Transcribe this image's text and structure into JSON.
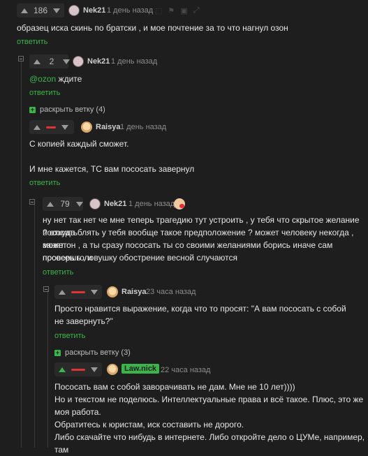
{
  "comments": [
    {
      "id": "c1",
      "score": "186",
      "author": "Nek21",
      "time": "1 день назад",
      "text": "образец иска скинь по братски , и мое почтение за то что нагнул озон",
      "reply": "ответить"
    },
    {
      "id": "c2",
      "score": "2",
      "author": "Nek21",
      "time": "1 день назад",
      "mention": "@ozon",
      "text": " ждите",
      "reply": "ответить",
      "expand": "раскрыть ветку (4)"
    },
    {
      "id": "c3",
      "author": "Raisya",
      "time": "1 день назад",
      "lines": [
        "С копией каждый сможет.",
        "И мне кажется, ТС вам пососать завернул"
      ],
      "reply": "ответить"
    },
    {
      "id": "c4",
      "score": "79",
      "author": "Nek21",
      "time": "1 день назад",
      "lines": [
        "ну нет так нет че мне теперь трагедию тут устроить , у тебя что скрытое желание пососать",
        "? откуда блять у тебя вообще такое предположение ? может человеку некогда , может",
        "занят он , а ты сразу пососать ты со своими желаниями борись иначе сам пососешь , и",
        "проверь головушку обострение весной случаются"
      ],
      "reply": "ответить"
    },
    {
      "id": "c5",
      "author": "Raisya",
      "time": "23 часа назад",
      "lines": [
        "Просто нравится выражение, когда что то просят: \"А вам пососать с собой",
        "не завернуть?\""
      ],
      "reply": "ответить",
      "expand": "раскрыть ветку (3)"
    },
    {
      "id": "c6",
      "author": "Law.nick",
      "time": "22 часа назад",
      "lines": [
        "Пососать вам с собой заворачивать не дам. Мне не 10 лет))))",
        "Но и текстом не поделюсь. Интеллектуальные права и всё такое. Плюс, это же",
        "моя работа.",
        "Обратитесь к юристам, иск составить не дорого.",
        "Либо скачайте что нибудь в интернете. Либо откройте дело о ЦУМе, например, там"
      ]
    }
  ],
  "colors": {
    "accent": "#3ab54a",
    "negative": "#e03333",
    "background": "#1e1e1e"
  }
}
